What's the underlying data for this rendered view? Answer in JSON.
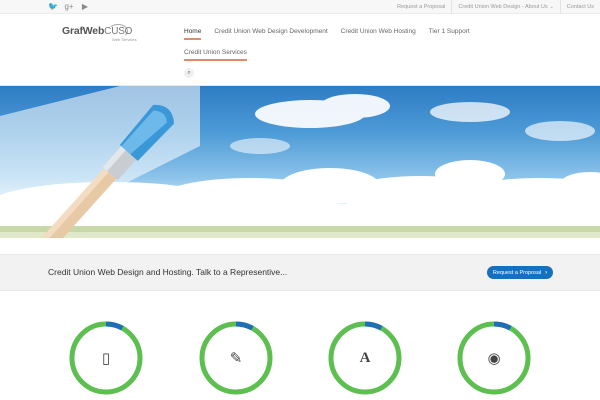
{
  "topbar": {
    "social": [
      {
        "icon": "twitter-icon",
        "glyph": "🐦"
      },
      {
        "icon": "google-plus-icon",
        "glyph": "g+"
      },
      {
        "icon": "youtube-icon",
        "glyph": "▶"
      }
    ],
    "links": {
      "proposal": "Request a Proposal",
      "about": "Credit Union Web Design - About Us",
      "contact": "Contact Us"
    }
  },
  "header": {
    "logo": {
      "main": "GrafWeb",
      "accent": "CUSO",
      "sub": "Web Services"
    },
    "nav": {
      "home": "Home",
      "design": "Credit Union Web Design Development",
      "hosting": "Credit Union Web Hosting",
      "support": "Tier 1 Support",
      "services": "Credit Union Services"
    }
  },
  "cta": {
    "text": "Credit Union Web Design and Hosting. Talk to a Representive...",
    "button": "Request a Proposal"
  },
  "features": [
    {
      "icon": "mobile-icon",
      "glyph": "▯",
      "progress": 0.08
    },
    {
      "icon": "pencil-icon",
      "glyph": "✎",
      "progress": 0.08
    },
    {
      "icon": "font-icon",
      "glyph": "A",
      "progress": 0.08
    },
    {
      "icon": "eye-icon",
      "glyph": "◉",
      "progress": 0.08
    }
  ],
  "colors": {
    "accent": "#1670bd",
    "ring": "#5cbf4f",
    "ring_progress": "#1f6fb6",
    "nav_underline": "#e08c6a"
  }
}
